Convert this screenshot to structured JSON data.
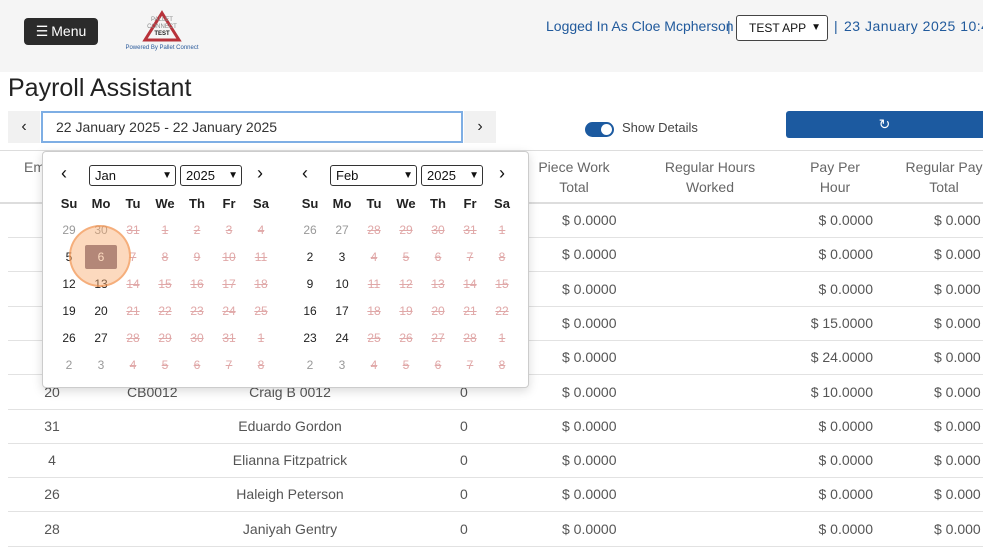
{
  "header": {
    "menu_label": "Menu",
    "logo_text": "PALLET CONNECT TEST",
    "logo_tagline": "Powered By Pallet Connect",
    "logged_in": "Logged In As Cloe Mcpherson",
    "separator": "|",
    "app_selected": "TEST APP",
    "datetime": "23 January 2025 10:4"
  },
  "page_title": "Payroll Assistant",
  "date_range": {
    "value": "22 January 2025 - 22 January 2025",
    "prev_label": "‹",
    "next_label": "›"
  },
  "show_details": {
    "label": "Show Details",
    "enabled": true
  },
  "refresh": {
    "icon": "refresh-icon",
    "label": "↻"
  },
  "table": {
    "columns": {
      "emp": "Em",
      "piece": [
        "Piece Work",
        "Total"
      ],
      "hours": [
        "Regular Hours",
        "Worked"
      ],
      "rate": [
        "Pay Per",
        "Hour"
      ],
      "total": [
        "Regular Pay",
        "Total"
      ]
    },
    "rows": [
      {
        "emp": "",
        "code": "",
        "name": "",
        "num": "",
        "piece": "$ 0.0000",
        "rate": "$ 0.0000",
        "total": "$ 0.000"
      },
      {
        "emp": "",
        "code": "",
        "name": "",
        "num": "",
        "piece": "$ 0.0000",
        "rate": "$ 0.0000",
        "total": "$ 0.000"
      },
      {
        "emp": "",
        "code": "",
        "name": "",
        "num": "",
        "piece": "$ 0.0000",
        "rate": "$ 0.0000",
        "total": "$ 0.000"
      },
      {
        "emp": "",
        "code": "",
        "name": "",
        "num": "",
        "piece": "$ 0.0000",
        "rate": "$ 15.0000",
        "total": "$ 0.000"
      },
      {
        "emp": "",
        "code": "",
        "name": "",
        "num": "",
        "piece": "$ 0.0000",
        "rate": "$ 24.0000",
        "total": "$ 0.000"
      },
      {
        "emp": "20",
        "code": "CB0012",
        "name": "Craig B 0012",
        "num": "0",
        "piece": "$ 0.0000",
        "rate": "$ 10.0000",
        "total": "$ 0.000"
      },
      {
        "emp": "31",
        "code": "",
        "name": "Eduardo Gordon",
        "num": "0",
        "piece": "$ 0.0000",
        "rate": "$ 0.0000",
        "total": "$ 0.000"
      },
      {
        "emp": "4",
        "code": "",
        "name": "Elianna Fitzpatrick",
        "num": "0",
        "piece": "$ 0.0000",
        "rate": "$ 0.0000",
        "total": "$ 0.000"
      },
      {
        "emp": "26",
        "code": "",
        "name": "Haleigh Peterson",
        "num": "0",
        "piece": "$ 0.0000",
        "rate": "$ 0.0000",
        "total": "$ 0.000"
      },
      {
        "emp": "28",
        "code": "",
        "name": "Janiyah Gentry",
        "num": "0",
        "piece": "$ 0.0000",
        "rate": "$ 0.0000",
        "total": "$ 0.000"
      }
    ]
  },
  "calendar": {
    "dow": [
      "Su",
      "Mo",
      "Tu",
      "We",
      "Th",
      "Fr",
      "Sa"
    ],
    "months": [
      {
        "month": "Jan",
        "year": "2025",
        "weeks": [
          [
            [
              "29",
              "off"
            ],
            [
              "30",
              "off"
            ],
            [
              "31",
              "dis"
            ],
            [
              "1",
              "dis"
            ],
            [
              "2",
              "dis"
            ],
            [
              "3",
              "dis"
            ],
            [
              "4",
              "dis"
            ]
          ],
          [
            [
              "5",
              ""
            ],
            [
              "6",
              "sel"
            ],
            [
              "7",
              "dis"
            ],
            [
              "8",
              "dis"
            ],
            [
              "9",
              "dis"
            ],
            [
              "10",
              "dis"
            ],
            [
              "11",
              "dis"
            ]
          ],
          [
            [
              "12",
              ""
            ],
            [
              "13",
              ""
            ],
            [
              "14",
              "dis"
            ],
            [
              "15",
              "dis"
            ],
            [
              "16",
              "dis"
            ],
            [
              "17",
              "dis"
            ],
            [
              "18",
              "dis"
            ]
          ],
          [
            [
              "19",
              ""
            ],
            [
              "20",
              ""
            ],
            [
              "21",
              "dis"
            ],
            [
              "22",
              "dis"
            ],
            [
              "23",
              "dis"
            ],
            [
              "24",
              "dis"
            ],
            [
              "25",
              "dis"
            ]
          ],
          [
            [
              "26",
              ""
            ],
            [
              "27",
              ""
            ],
            [
              "28",
              "dis"
            ],
            [
              "29",
              "dis"
            ],
            [
              "30",
              "dis"
            ],
            [
              "31",
              "dis"
            ],
            [
              "1",
              "dis"
            ]
          ],
          [
            [
              "2",
              "off"
            ],
            [
              "3",
              "off"
            ],
            [
              "4",
              "dis"
            ],
            [
              "5",
              "dis"
            ],
            [
              "6",
              "dis"
            ],
            [
              "7",
              "dis"
            ],
            [
              "8",
              "dis"
            ]
          ]
        ]
      },
      {
        "month": "Feb",
        "year": "2025",
        "weeks": [
          [
            [
              "26",
              "off"
            ],
            [
              "27",
              "off"
            ],
            [
              "28",
              "dis"
            ],
            [
              "29",
              "dis"
            ],
            [
              "30",
              "dis"
            ],
            [
              "31",
              "dis"
            ],
            [
              "1",
              "dis"
            ]
          ],
          [
            [
              "2",
              ""
            ],
            [
              "3",
              ""
            ],
            [
              "4",
              "dis"
            ],
            [
              "5",
              "dis"
            ],
            [
              "6",
              "dis"
            ],
            [
              "7",
              "dis"
            ],
            [
              "8",
              "dis"
            ]
          ],
          [
            [
              "9",
              ""
            ],
            [
              "10",
              ""
            ],
            [
              "11",
              "dis"
            ],
            [
              "12",
              "dis"
            ],
            [
              "13",
              "dis"
            ],
            [
              "14",
              "dis"
            ],
            [
              "15",
              "dis"
            ]
          ],
          [
            [
              "16",
              ""
            ],
            [
              "17",
              ""
            ],
            [
              "18",
              "dis"
            ],
            [
              "19",
              "dis"
            ],
            [
              "20",
              "dis"
            ],
            [
              "21",
              "dis"
            ],
            [
              "22",
              "dis"
            ]
          ],
          [
            [
              "23",
              ""
            ],
            [
              "24",
              ""
            ],
            [
              "25",
              "dis"
            ],
            [
              "26",
              "dis"
            ],
            [
              "27",
              "dis"
            ],
            [
              "28",
              "dis"
            ],
            [
              "1",
              "dis"
            ]
          ],
          [
            [
              "2",
              "off"
            ],
            [
              "3",
              "off"
            ],
            [
              "4",
              "dis"
            ],
            [
              "5",
              "dis"
            ],
            [
              "6",
              "dis"
            ],
            [
              "7",
              "dis"
            ],
            [
              "8",
              "dis"
            ]
          ]
        ]
      }
    ]
  }
}
